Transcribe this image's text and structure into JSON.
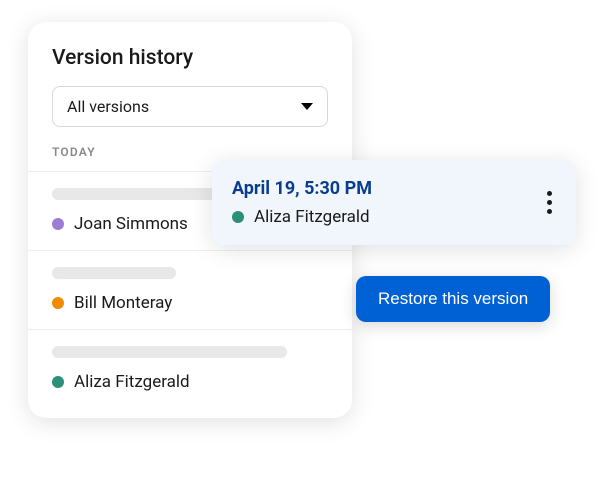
{
  "panel": {
    "title": "Version history",
    "filter": {
      "selected": "All versions"
    },
    "section_label": "TODAY",
    "versions": [
      {
        "author": "Joan Simmons",
        "color": "purple"
      },
      {
        "author": "Bill Monteray",
        "color": "orange"
      },
      {
        "author": "Aliza Fitzgerald",
        "color": "teal"
      }
    ]
  },
  "popover": {
    "timestamp": "April 19, 5:30 PM",
    "author": "Aliza Fitzgerald",
    "author_color": "teal"
  },
  "actions": {
    "restore_label": "Restore this version"
  }
}
